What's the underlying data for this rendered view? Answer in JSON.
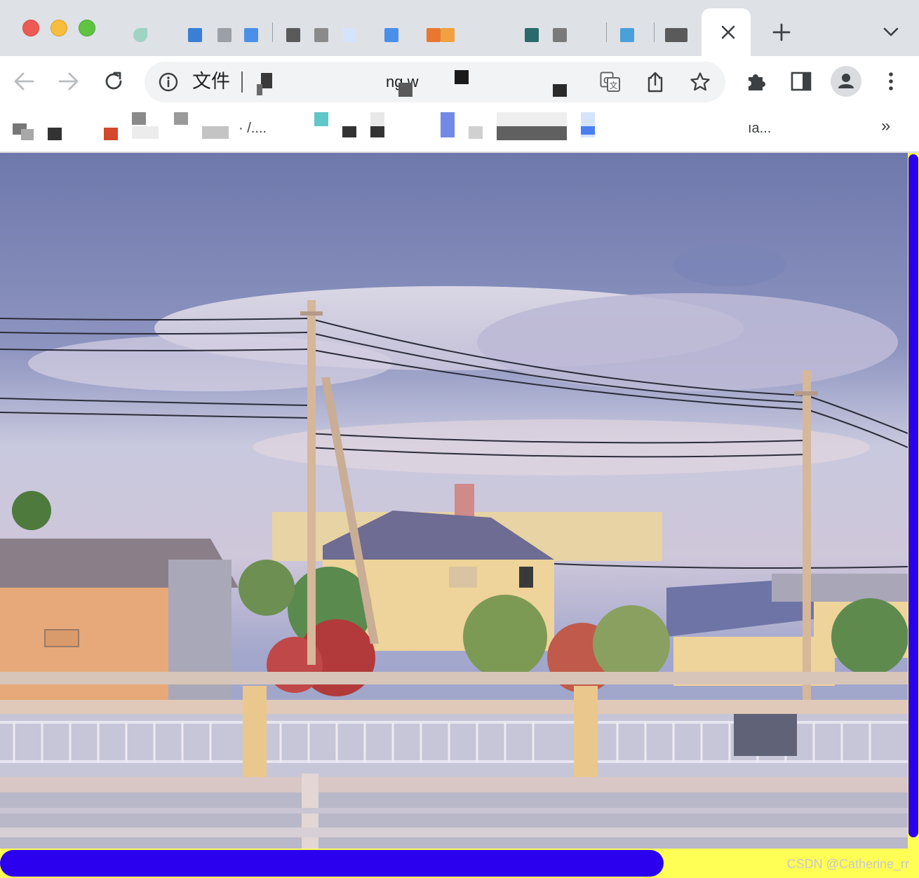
{
  "tabs": {
    "favicon_colors": [
      "#7fc3b0",
      "#3b7ed6",
      "#9aa0a6",
      "#555555",
      "#6d6d6d",
      "#4b8fe8",
      "#e8772f",
      "#2a6a6a",
      "#7a7a7a",
      "#4aa0d8",
      "#5a5a5a"
    ],
    "close_tab_icon": "close-icon",
    "new_tab_icon": "plus-icon",
    "tab_search_icon": "chevron-down-icon"
  },
  "toolbar": {
    "back_icon": "arrow-left-icon",
    "forward_icon": "arrow-right-icon",
    "reload_icon": "reload-icon",
    "omnibox": {
      "scheme_label": "文件",
      "url_fragment": "ng.w"
    },
    "translate_icon": "translate-icon",
    "share_icon": "share-icon",
    "bookmark_icon": "star-icon",
    "extensions_icon": "puzzle-icon",
    "sidepanel_icon": "side-panel-icon",
    "profile_icon": "avatar-icon",
    "menu_icon": "kebab-menu-icon"
  },
  "bookmarks": {
    "items": [
      {
        "label": "· /....",
        "color": "#3c4043"
      },
      {
        "label": "",
        "color": "#5fc7c7"
      },
      {
        "label": "",
        "color": "#7389e6"
      },
      {
        "label": "ıa...",
        "color": "#3c4043"
      }
    ],
    "overflow_label": "»"
  },
  "viewport": {
    "scene": "photo-suburban-power-lines",
    "scrollbar_color": "#2b00ee",
    "page_background": "#ffff55",
    "watermark": "CSDN @Catherine_rr"
  }
}
